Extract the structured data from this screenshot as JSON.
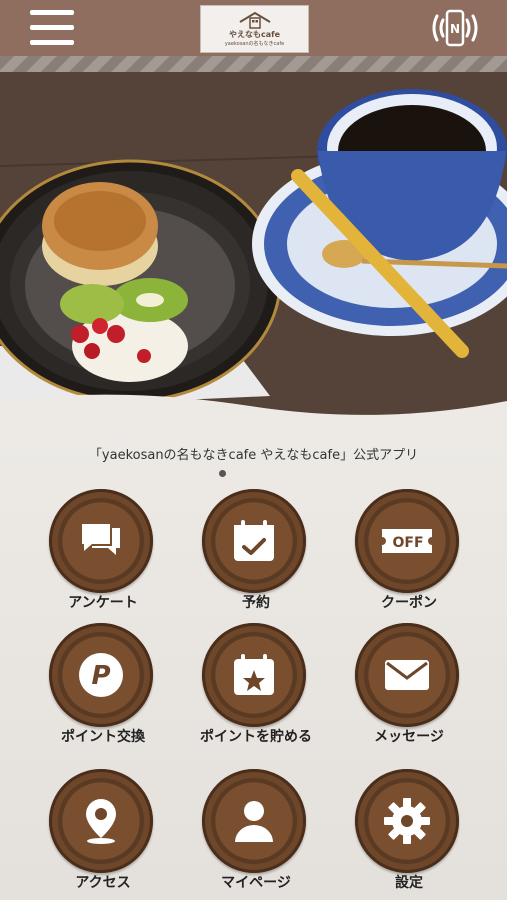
{
  "header": {
    "logo_line1": "やえなもcafe",
    "logo_line2": "yaekosanの名もなきcafe"
  },
  "tagline": "「yaekosanの名もなきcafe やえなもcafe」公式アプリ",
  "menu": [
    {
      "label": "アンケート",
      "icon": "chat-icon"
    },
    {
      "label": "予約",
      "icon": "calendar-check-icon"
    },
    {
      "label": "クーポン",
      "icon": "coupon-off-icon"
    },
    {
      "label": "ポイント交換",
      "icon": "p-point-icon"
    },
    {
      "label": "ポイントを貯める",
      "icon": "calendar-star-icon"
    },
    {
      "label": "メッセージ",
      "icon": "envelope-icon"
    },
    {
      "label": "アクセス",
      "icon": "map-pin-icon"
    },
    {
      "label": "マイページ",
      "icon": "user-icon"
    },
    {
      "label": "設定",
      "icon": "gear-icon"
    }
  ],
  "coupon_icon_text": "OFF"
}
